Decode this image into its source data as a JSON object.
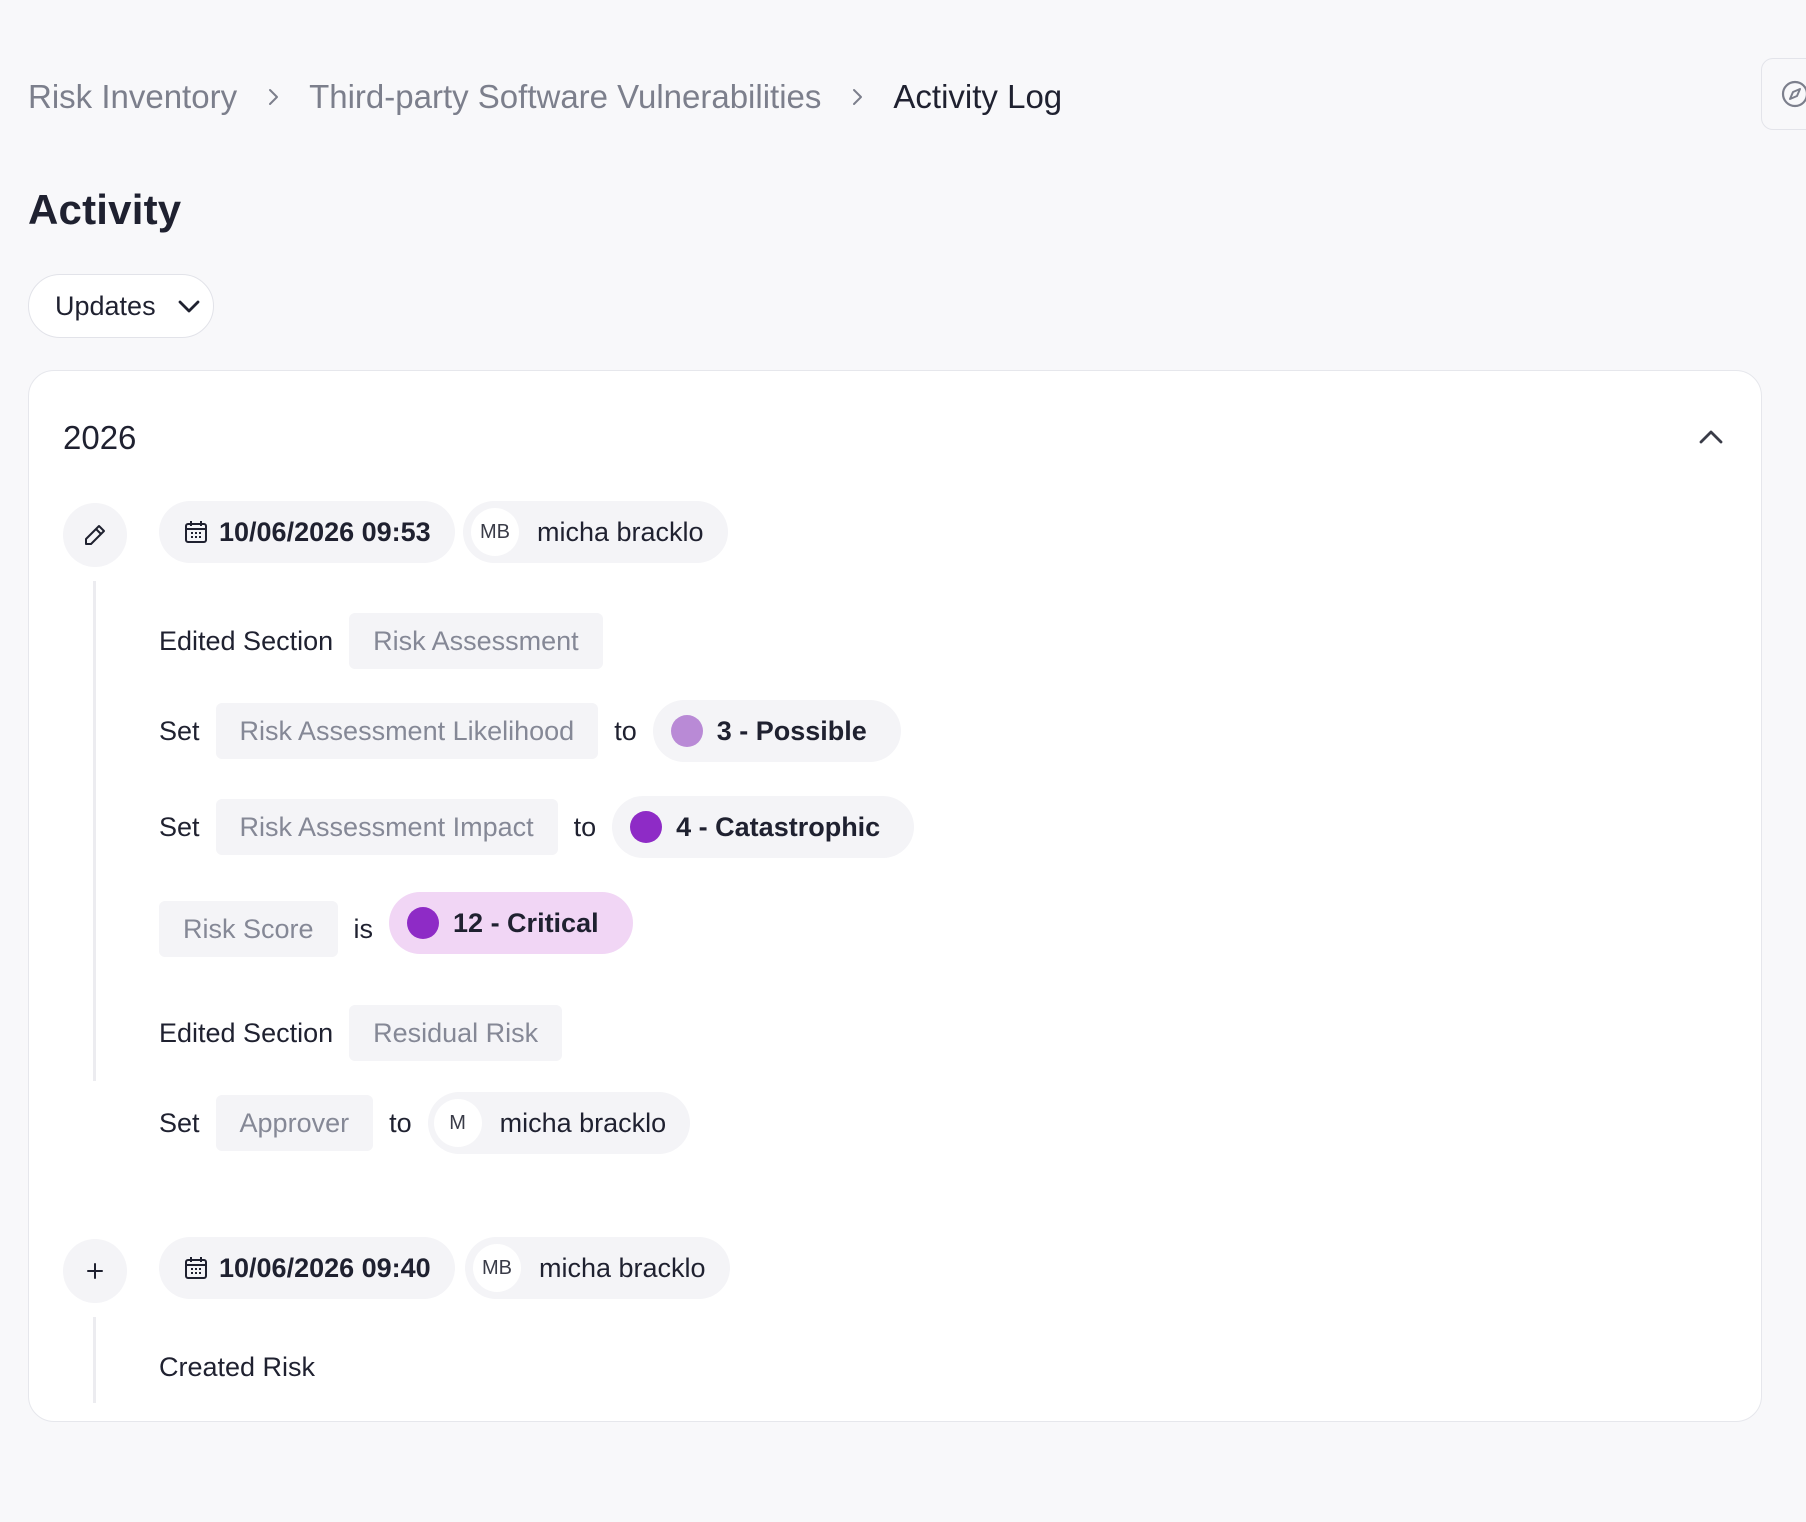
{
  "breadcrumb": {
    "items": [
      "Risk Inventory",
      "Third-party Software Vulnerabilities",
      "Activity Log"
    ]
  },
  "page": {
    "title": "Activity",
    "filter_label": "Updates"
  },
  "group": {
    "year": "2026"
  },
  "entries": [
    {
      "icon": "pencil-icon",
      "date": "10/06/2026 09:53",
      "user_initials": "MB",
      "user_name": "micha bracklo",
      "rows": {
        "r1": {
          "label": "Edited Section",
          "tag": "Risk Assessment"
        },
        "r2": {
          "verb": "Set",
          "tag": "Risk Assessment Likelihood",
          "conj": "to",
          "value": "3 - Possible",
          "dot_color": "#b98ad6"
        },
        "r3": {
          "verb": "Set",
          "tag": "Risk Assessment Impact",
          "conj": "to",
          "value": "4 - Catastrophic",
          "dot_color": "#8e2bc6"
        },
        "r4": {
          "tag": "Risk Score",
          "conj": "is",
          "value": "12 - Critical",
          "dot_color": "#8e2bc6"
        },
        "r5": {
          "label": "Edited Section",
          "tag": "Residual Risk"
        },
        "r6": {
          "verb": "Set",
          "tag": "Approver",
          "conj": "to",
          "avatar": "M",
          "value": "micha bracklo"
        }
      }
    },
    {
      "icon": "plus-icon",
      "date": "10/06/2026 09:40",
      "user_initials": "MB",
      "user_name": "micha bracklo",
      "text": "Created Risk"
    }
  ]
}
